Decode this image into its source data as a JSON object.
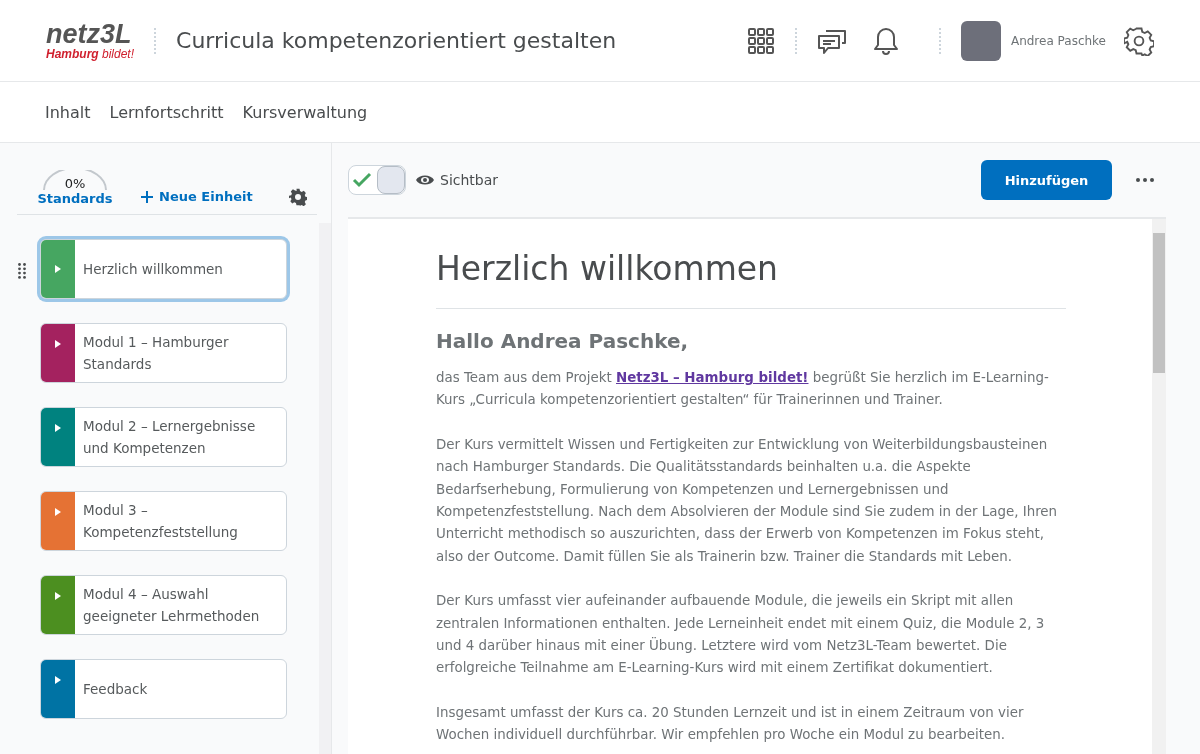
{
  "header": {
    "logo": {
      "top": "netz3L",
      "bottom_bold": "Hamburg",
      "bottom": "bildet!"
    },
    "title": "Curricula kompetenzorientiert gestalten",
    "user": "Andrea Paschke"
  },
  "nav": [
    {
      "label": "Inhalt"
    },
    {
      "label": "Lernfortschritt"
    },
    {
      "label": "Kursverwaltung"
    }
  ],
  "sidebar": {
    "progress": {
      "reading": "0%",
      "label": "Standards"
    },
    "new_unit": "Neue Einheit",
    "items": [
      {
        "title": "Herzlich willkommen",
        "color": "#46a661",
        "selected": true
      },
      {
        "title": "Modul 1 – Hamburger Standards",
        "color": "#a4225f",
        "selected": false
      },
      {
        "title": "Modul 2 – Lernergebnisse und Kompetenzen",
        "color": "#00827f",
        "selected": false
      },
      {
        "title": "Modul 3 – Kompetenzfeststellung",
        "color": "#e57234",
        "selected": false
      },
      {
        "title": "Modul 4 – Auswahl geeigneter Lehrmethoden",
        "color": "#4c8f20",
        "selected": false
      },
      {
        "title": "Feedback",
        "color": "#0073a4",
        "selected": false
      }
    ]
  },
  "toolbar": {
    "visible": true,
    "visible_label": "Sichtbar",
    "add_button": "Hinzufügen"
  },
  "content": {
    "heading": "Herzlich willkommen",
    "greeting": "Hallo Andrea Paschke,",
    "intro_before": "das Team aus dem Projekt",
    "intro_link": "Netz3L – Hamburg bildet!",
    "intro_after": "begrüßt Sie herzlich im E-Learning-Kurs „Curricula kompetenzorientiert gestalten“ für Trainerinnen und Trainer.",
    "paragraphs": [
      "Der Kurs vermittelt Wissen und Fertigkeiten zur Entwicklung von Weiterbildungsbausteinen nach Hamburger Standards. Die Qualitätsstandards beinhalten u.a. die Aspekte Bedarfserhebung, Formulierung von Kompetenzen und Lernergebnissen und Kompetenzfeststellung. Nach dem Absolvieren der Module sind Sie zudem in der Lage, Ihren Unterricht methodisch so auszurichten, dass der Erwerb von Kompetenzen im Fokus steht, also der Outcome. Damit füllen Sie als Trainerin bzw. Trainer die Standards mit Leben.",
      "Der Kurs umfasst vier aufeinander aufbauende Module, die jeweils ein Skript mit allen zentralen Informationen enthalten. Jede Lerneinheit endet mit einem Quiz, die Module 2, 3 und 4 darüber hinaus mit einer Übung. Letztere wird vom Netz3L-Team bewertet. Die erfolgreiche Teilnahme am E-Learning-Kurs wird mit einem Zertifikat dokumentiert.",
      "Insgesamt umfasst der Kurs ca. 20 Stunden Lernzeit und ist in einem Zeitraum von vier Wochen individuell durchführbar. Wir empfehlen pro Woche ein Modul zu bearbeiten."
    ]
  }
}
